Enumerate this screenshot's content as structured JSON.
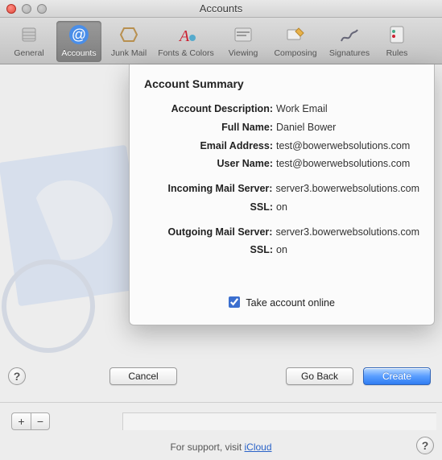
{
  "window": {
    "title": "Accounts"
  },
  "toolbar": {
    "items": [
      {
        "label": "General"
      },
      {
        "label": "Accounts"
      },
      {
        "label": "Junk Mail"
      },
      {
        "label": "Fonts & Colors"
      },
      {
        "label": "Viewing"
      },
      {
        "label": "Composing"
      },
      {
        "label": "Signatures"
      },
      {
        "label": "Rules"
      }
    ]
  },
  "sheet": {
    "title": "Account Summary",
    "rows": {
      "description_label": "Account Description:",
      "description_value": "Work Email",
      "fullname_label": "Full Name:",
      "fullname_value": "Daniel Bower",
      "email_label": "Email Address:",
      "email_value": "test@bowerwebsolutions.com",
      "username_label": "User Name:",
      "username_value": "test@bowerwebsolutions.com",
      "incoming_label": "Incoming Mail Server:",
      "incoming_value": "server3.bowerwebsolutions.com",
      "in_ssl_label": "SSL:",
      "in_ssl_value": "on",
      "outgoing_label": "Outgoing Mail Server:",
      "outgoing_value": "server3.bowerwebsolutions.com",
      "out_ssl_label": "SSL:",
      "out_ssl_value": "on"
    },
    "online_label": "Take account online",
    "online_checked": true
  },
  "buttons": {
    "cancel": "Cancel",
    "goback": "Go Back",
    "create": "Create"
  },
  "addremove": {
    "add": "+",
    "remove": "−"
  },
  "support": {
    "prefix": "For support, visit ",
    "link_text": "iCloud"
  },
  "help_glyph": "?"
}
